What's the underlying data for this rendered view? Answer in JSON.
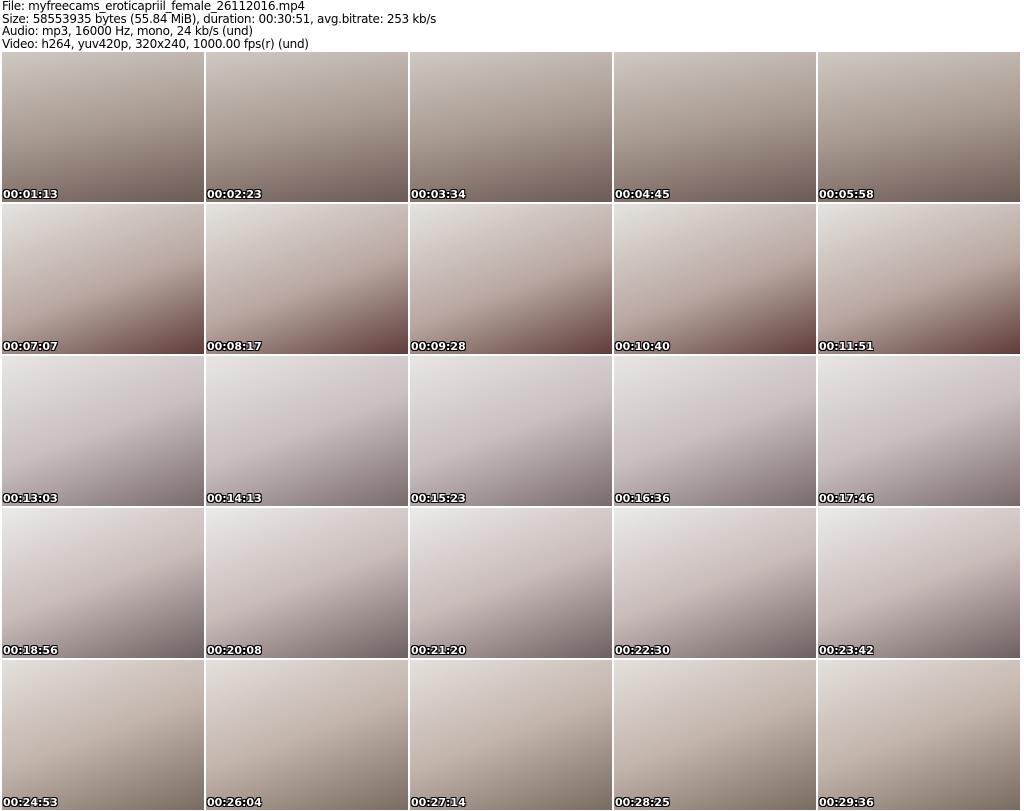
{
  "header": {
    "file": "File: myfreecams_eroticapriil_female_26112016.mp4",
    "size": "Size: 58553935 bytes (55.84 MiB), duration: 00:30:51, avg.bitrate: 253 kb/s",
    "audio": "Audio: mp3, 16000 Hz, mono, 24 kb/s (und)",
    "video": "Video: h264, yuv420p, 320x240, 1000.00 fps(r) (und)"
  },
  "thumbnails": [
    "00:01:13",
    "00:02:23",
    "00:03:34",
    "00:04:45",
    "00:05:58",
    "00:07:07",
    "00:08:17",
    "00:09:28",
    "00:10:40",
    "00:11:51",
    "00:13:03",
    "00:14:13",
    "00:15:23",
    "00:16:36",
    "00:17:46",
    "00:18:56",
    "00:20:08",
    "00:21:20",
    "00:22:30",
    "00:23:42",
    "00:24:53",
    "00:26:04",
    "00:27:14",
    "00:28:25",
    "00:29:36"
  ]
}
